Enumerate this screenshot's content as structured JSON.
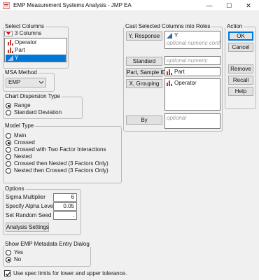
{
  "window": {
    "title": "EMP Measurement Systems Analysis - JMP EA",
    "minimize_glyph": "—",
    "maximize_glyph": "☐",
    "close_glyph": "✕"
  },
  "select_columns": {
    "title": "Select Columns",
    "count_label": "3 Columns",
    "items": [
      {
        "label": "Operator",
        "icon": "nominal-column-icon",
        "selected": false
      },
      {
        "label": "Part",
        "icon": "nominal-column-icon",
        "selected": false
      },
      {
        "label": "Y",
        "icon": "continuous-column-icon",
        "selected": true
      }
    ]
  },
  "cast_roles": {
    "title": "Cast Selected Columns into Roles",
    "roles": [
      {
        "button": "Y, Response",
        "value": "Y",
        "icon": "continuous-column-icon",
        "placeholder": "optional numeric conti"
      },
      {
        "button": "Standard",
        "value": "",
        "placeholder": "optional numeric"
      },
      {
        "button": "Part, Sample ID",
        "value": "Part",
        "icon": "nominal-column-icon",
        "placeholder": ""
      },
      {
        "button": "X, Grouping",
        "value": "Operator",
        "icon": "nominal-column-icon",
        "placeholder": ""
      },
      {
        "button": "By",
        "value": "",
        "placeholder": "optional"
      }
    ]
  },
  "action": {
    "title": "Action",
    "ok": "OK",
    "cancel": "Cancel",
    "remove": "Remove",
    "recall": "Recall",
    "help": "Help"
  },
  "msa_method": {
    "title": "MSA Method",
    "selected": "EMP"
  },
  "chart_dispersion": {
    "title": "Chart Dispersion Type",
    "options": [
      {
        "label": "Range",
        "selected": true
      },
      {
        "label": "Standard Deviation",
        "selected": false
      }
    ]
  },
  "model_type": {
    "title": "Model Type",
    "options": [
      {
        "label": "Main",
        "selected": false
      },
      {
        "label": "Crossed",
        "selected": true
      },
      {
        "label": "Crossed with Two Factor Interactions",
        "selected": false
      },
      {
        "label": "Nested",
        "selected": false
      },
      {
        "label": "Crossed then Nested (3 Factors Only)",
        "selected": false
      },
      {
        "label": "Nested then Crossed (3 Factors Only)",
        "selected": false
      }
    ]
  },
  "options": {
    "title": "Options",
    "sigma_label": "Sigma Multiplier",
    "sigma_value": "6",
    "alpha_label": "Specify Alpha Level",
    "alpha_value": "0.05",
    "seed_label": "Set Random Seed",
    "seed_value": ".",
    "analysis_settings": "Analysis Settings"
  },
  "metadata_dialog": {
    "title": "Show EMP Metadata Entry Dialog",
    "options": [
      {
        "label": "Yes",
        "selected": false
      },
      {
        "label": "No",
        "selected": true
      }
    ]
  },
  "spec_limits": {
    "label": "Use spec limits for lower and upper tolerance.",
    "checked": true
  },
  "colors": {
    "nominal_icon": "#c0392b",
    "continuous_icon": "#2f64b5",
    "selection": "#0078d7"
  }
}
